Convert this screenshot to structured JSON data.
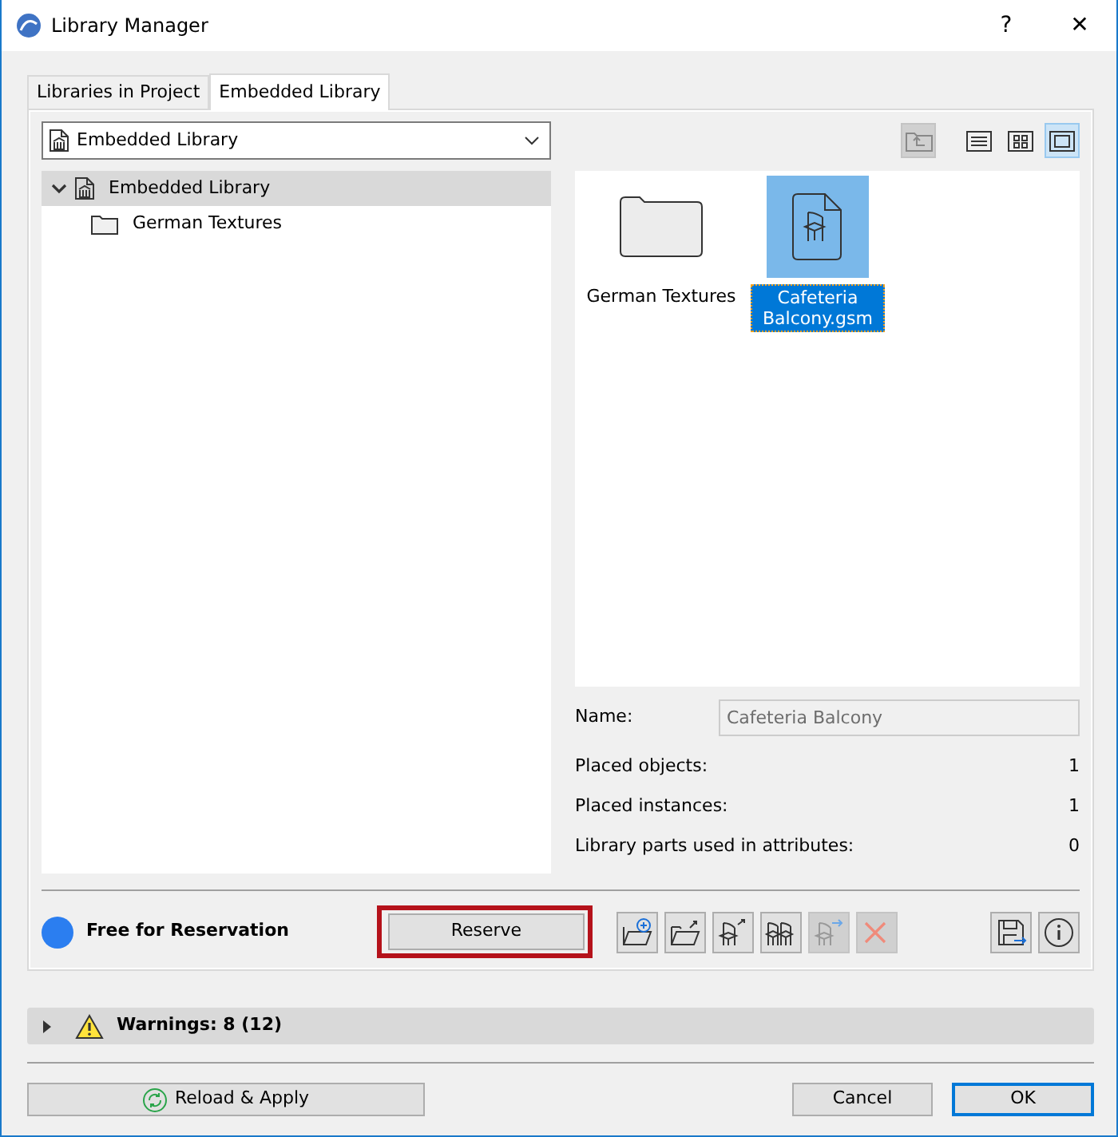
{
  "window": {
    "title": "Library Manager",
    "help": "?",
    "close": "✕"
  },
  "tabs": [
    {
      "label": "Libraries in Project",
      "selected": false
    },
    {
      "label": "Embedded Library",
      "selected": true
    }
  ],
  "library_dropdown": {
    "value": "Embedded Library"
  },
  "tree": [
    {
      "label": "Embedded Library",
      "kind": "library",
      "expanded": true,
      "selected": true,
      "children": [
        {
          "label": "German Textures",
          "kind": "folder",
          "selected": false
        }
      ]
    }
  ],
  "view_toolbar": [
    {
      "kind": "up-folder",
      "disabled": true,
      "selected": false
    },
    {
      "kind": "list",
      "disabled": false,
      "selected": false
    },
    {
      "kind": "grid",
      "disabled": false,
      "selected": false
    },
    {
      "kind": "large",
      "disabled": false,
      "selected": true
    }
  ],
  "items": [
    {
      "label": "German Textures",
      "kind": "folder",
      "selected": false
    },
    {
      "label": "Cafeteria Balcony.gsm",
      "kind": "object",
      "selected": true
    }
  ],
  "details": {
    "name_label": "Name:",
    "name_value": "Cafeteria Balcony",
    "stats": [
      {
        "label": "Placed objects:",
        "value": "1"
      },
      {
        "label": "Placed instances:",
        "value": "1"
      },
      {
        "label": "Library parts used in attributes:",
        "value": "0"
      }
    ]
  },
  "status": {
    "label": "Free for Reservation",
    "color": "#2b7ef0"
  },
  "reserve_button": {
    "label": "Reserve",
    "highlighted": true
  },
  "tool_buttons": [
    {
      "kind": "add-folder",
      "disabled": false
    },
    {
      "kind": "export-folder",
      "disabled": false
    },
    {
      "kind": "export-object",
      "disabled": false
    },
    {
      "kind": "objects",
      "disabled": false
    },
    {
      "kind": "move-object",
      "disabled": true
    },
    {
      "kind": "delete",
      "disabled": true
    }
  ],
  "side_buttons": [
    {
      "kind": "save"
    },
    {
      "kind": "info"
    }
  ],
  "warnings": {
    "label": "Warnings: 8 (12)",
    "expanded": false
  },
  "footer_buttons": [
    {
      "label": "Reload & Apply",
      "kind": "reload",
      "default": false
    },
    {
      "label": "Cancel",
      "kind": "plain",
      "default": false
    },
    {
      "label": "OK",
      "kind": "plain",
      "default": true
    }
  ]
}
